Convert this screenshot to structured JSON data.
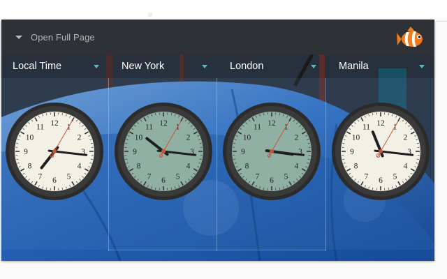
{
  "header": {
    "open_full_label": "Open Full Page",
    "logo_icon": "clownfish-logo-icon"
  },
  "clocks": [
    {
      "name": "Local Time",
      "face": "#f3f0e6",
      "hours": 7,
      "minutes": 16,
      "seconds": 5
    },
    {
      "name": "New York",
      "face": "#8fb0a3",
      "hours": 10,
      "minutes": 16,
      "seconds": 5
    },
    {
      "name": "London",
      "face": "#8fb0a3",
      "hours": 3,
      "minutes": 16,
      "seconds": 5
    },
    {
      "name": "Manila",
      "face": "#f3f0e6",
      "hours": 11,
      "minutes": 16,
      "seconds": 5
    }
  ],
  "dial_numbers": [
    "12",
    "1",
    "2",
    "3",
    "4",
    "5",
    "6",
    "7",
    "8",
    "9",
    "10",
    "11"
  ],
  "colors": {
    "header_bg": "#2e3135",
    "accent": "#4fc1c4",
    "bezel": "#3a3a3a",
    "second_hand": "#c8533a"
  }
}
